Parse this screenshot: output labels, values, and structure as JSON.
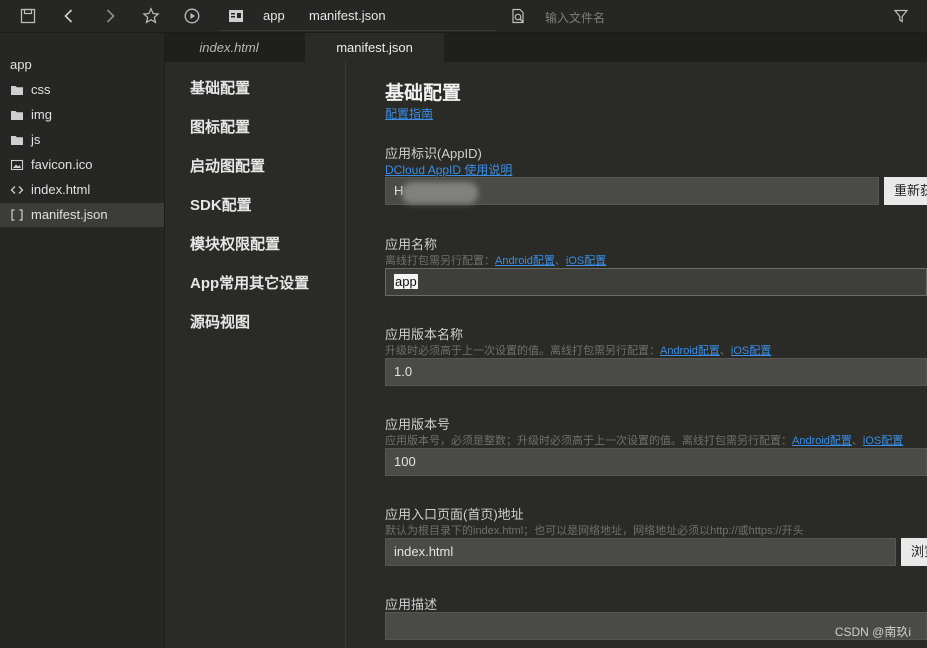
{
  "toolbar": {
    "breadcrumb": [
      "app",
      "manifest.json"
    ],
    "search_placeholder": "输入文件名",
    "icons": [
      "save-icon",
      "back-icon",
      "forward-icon",
      "star-icon",
      "run-icon",
      "preview-icon",
      "find-file-icon",
      "filter-icon"
    ]
  },
  "tree": {
    "items": [
      {
        "label": "app",
        "icon": "none"
      },
      {
        "label": "css",
        "icon": "folder-icon"
      },
      {
        "label": "img",
        "icon": "folder-icon"
      },
      {
        "label": "js",
        "icon": "folder-icon"
      },
      {
        "label": "favicon.ico",
        "icon": "image-icon"
      },
      {
        "label": "index.html",
        "icon": "code-icon"
      },
      {
        "label": "manifest.json",
        "icon": "json-icon"
      }
    ]
  },
  "tabs": [
    {
      "label": "index.html",
      "active": false
    },
    {
      "label": "manifest.json",
      "active": true
    }
  ],
  "nav": [
    "基础配置",
    "图标配置",
    "启动图配置",
    "SDK配置",
    "模块权限配置",
    "App常用其它设置",
    "源码视图"
  ],
  "form": {
    "title": "基础配置",
    "guide_link": "配置指南",
    "appid": {
      "label": "应用标识(AppID)",
      "link": "DCloud AppID 使用说明",
      "value": "H",
      "button": "重新获取"
    },
    "app_name": {
      "label": "应用名称",
      "hint_prefix": "离线打包需另行配置：",
      "hint_link1": "Android配置",
      "hint_sep": "、",
      "hint_link2": "iOS配置",
      "value": "app"
    },
    "version_name": {
      "label": "应用版本名称",
      "hint_prefix": "升级时必须高于上一次设置的值。离线打包需另行配置：",
      "hint_link1": "Android配置",
      "hint_sep": "、",
      "hint_link2": "iOS配置",
      "value": "1.0"
    },
    "version_code": {
      "label": "应用版本号",
      "hint_prefix": "应用版本号，必须是整数；升级时必须高于上一次设置的值。离线打包需另行配置：",
      "hint_link1": "Android配置",
      "hint_sep": "、",
      "hint_link2": "iOS配置",
      "value": "100"
    },
    "entry": {
      "label": "应用入口页面(首页)地址",
      "hint": "默认为根目录下的index.html；也可以是网络地址，网络地址必须以http://或https://开头",
      "value": "index.html",
      "button": "浏览"
    },
    "description": {
      "label": "应用描述",
      "value": ""
    }
  },
  "watermark": "CSDN @南玖i"
}
